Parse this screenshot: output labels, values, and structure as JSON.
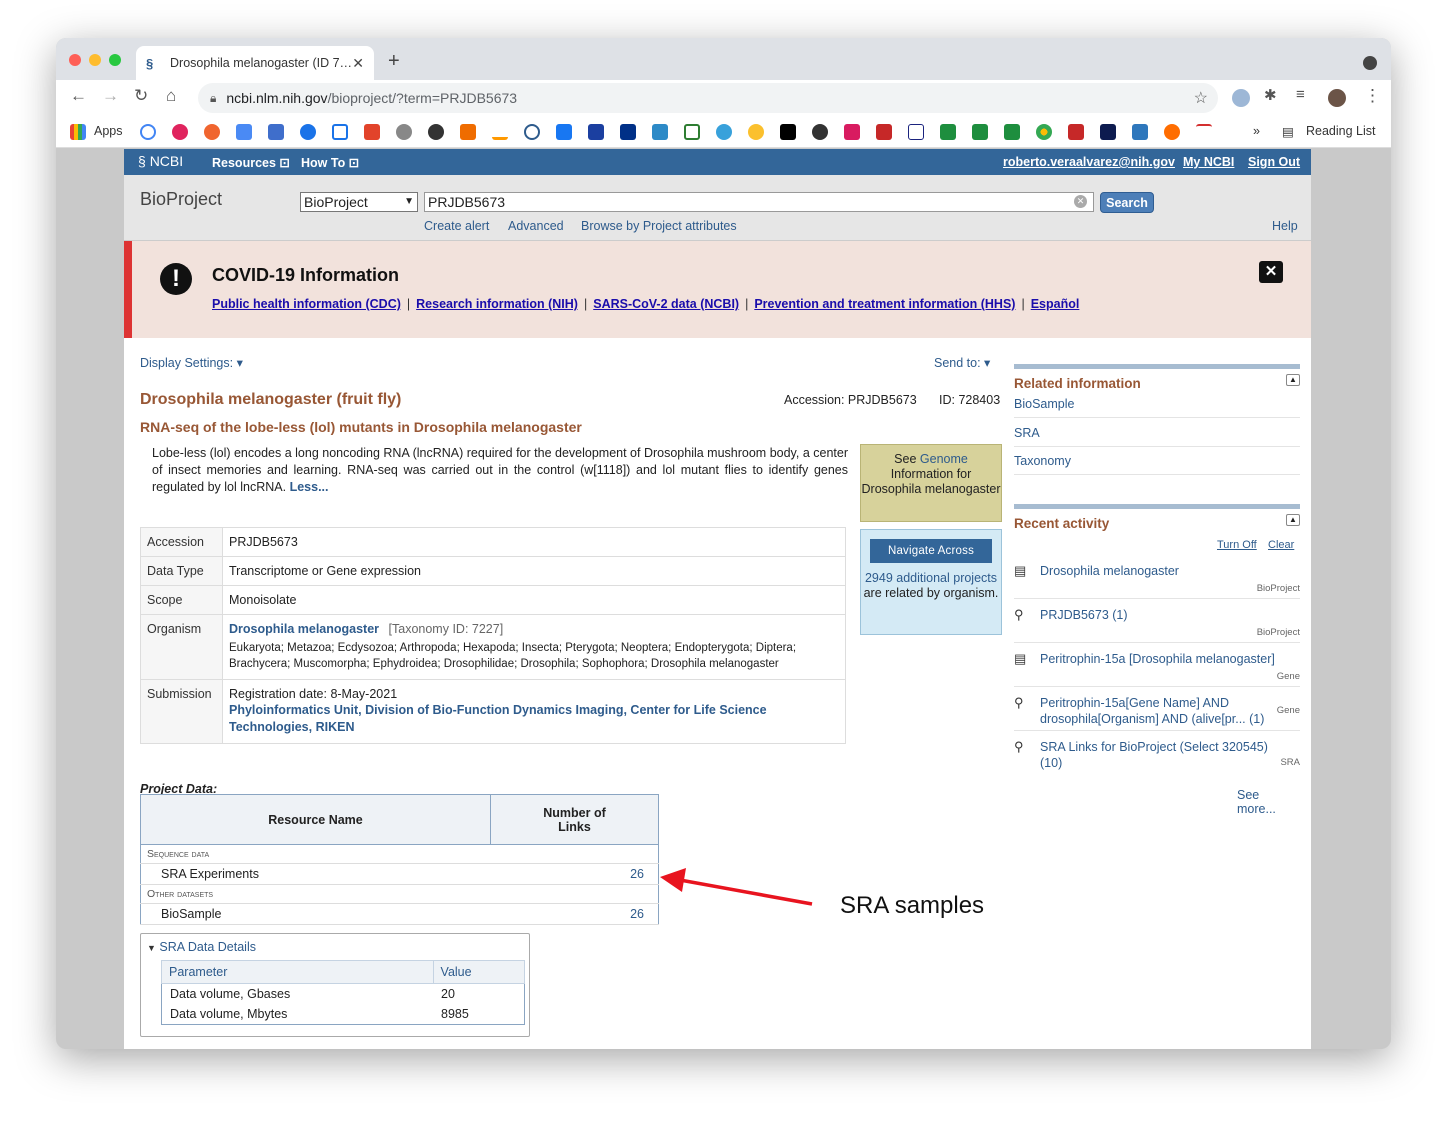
{
  "browser": {
    "tab_title": "Drosophila melanogaster (ID 7…",
    "url_domain": "ncbi.nlm.nih.gov",
    "url_path": "/bioproject/?term=PRJDB5673",
    "bookmarks_apps": "Apps",
    "bookmarks_more": "»",
    "reading_list": "Reading List"
  },
  "ncbi_bar": {
    "logo": "NCBI",
    "resources": "Resources",
    "how_to": "How To",
    "user": "roberto.veraalvarez@nih.gov",
    "my_ncbi": "My NCBI",
    "sign_out": "Sign Out"
  },
  "search": {
    "db_title": "BioProject",
    "db_selected": "BioProject",
    "term": "PRJDB5673",
    "button": "Search",
    "create_alert": "Create alert",
    "advanced": "Advanced",
    "browse": "Browse by Project attributes",
    "help": "Help"
  },
  "covid": {
    "title": "COVID-19 Information",
    "links": [
      "Public health information (CDC)",
      "Research information (NIH)",
      "SARS-CoV-2 data (NCBI)",
      "Prevention and treatment information (HHS)",
      "Español"
    ],
    "separator": "|"
  },
  "display_settings": "Display Settings:",
  "send_to": "Send to:",
  "record": {
    "organism_title": "Drosophila melanogaster (fruit fly)",
    "accession_label": "Accession: PRJDB5673",
    "id_label": "ID: 728403",
    "project_title": "RNA-seq of the lobe-less (lol) mutants in Drosophila melanogaster",
    "description": "Lobe-less (lol) encodes a long noncoding RNA (lncRNA) required for the development of Drosophila mushroom body, a center of insect memories and learning. RNA-seq was carried out in the control (w[1118]) and lol mutant flies to identify genes regulated by lol lncRNA.",
    "less": "Less..."
  },
  "genome_box": {
    "see": "See",
    "genome": "Genome",
    "rest": "Information for Drosophila melanogaster"
  },
  "navigate_box": {
    "heading": "Navigate Across",
    "link": "2949 additional projects",
    "rest": "are related by organism."
  },
  "info_table": {
    "accession_label": "Accession",
    "accession": "PRJDB5673",
    "data_type_label": "Data Type",
    "data_type": "Transcriptome or Gene expression",
    "scope_label": "Scope",
    "scope": "Monoisolate",
    "organism_label": "Organism",
    "organism": "Drosophila melanogaster",
    "taxonomy": "[Taxonomy ID: 7227]",
    "lineage": "Eukaryota; Metazoa; Ecdysozoa; Arthropoda; Hexapoda; Insecta; Pterygota; Neoptera; Endopterygota; Diptera; Brachycera; Muscomorpha; Ephydroidea; Drosophilidae; Drosophila; Sophophora; Drosophila melanogaster",
    "submission_label": "Submission",
    "registration": "Registration date: 8-May-2021",
    "submitter": "Phyloinformatics Unit, Division of Bio-Function Dynamics Imaging, Center for Life Science Technologies, RIKEN"
  },
  "project_data": {
    "heading": "Project Data:",
    "col_resource": "Resource Name",
    "col_links": "Number of Links",
    "cat_sequence": "Sequence data",
    "sra_experiments": "SRA Experiments",
    "sra_count": "26",
    "cat_other": "Other datasets",
    "biosample": "BioSample",
    "biosample_count": "26"
  },
  "sra_details": {
    "heading": "SRA Data Details",
    "col_param": "Parameter",
    "col_value": "Value",
    "rows": [
      {
        "param": "Data volume, Gbases",
        "value": "20"
      },
      {
        "param": "Data volume, Mbytes",
        "value": "8985"
      }
    ]
  },
  "related": {
    "title": "Related information",
    "links": [
      "BioSample",
      "SRA",
      "Taxonomy"
    ]
  },
  "recent": {
    "title": "Recent activity",
    "turn_off": "Turn Off",
    "clear": "Clear",
    "items": [
      {
        "text": "Drosophila melanogaster",
        "db": "BioProject",
        "icon": "document-icon"
      },
      {
        "text": "PRJDB5673 (1)",
        "db": "BioProject",
        "icon": "search-icon"
      },
      {
        "text": "Peritrophin-15a [Drosophila melanogaster]",
        "db": "Gene",
        "icon": "document-icon"
      },
      {
        "text": "Peritrophin-15a[Gene Name] AND drosophila[Organism] AND (alive[pr... (1)",
        "db": "Gene",
        "icon": "search-icon"
      },
      {
        "text": "SRA Links for BioProject (Select 320545) (10)",
        "db": "SRA",
        "icon": "search-icon"
      }
    ],
    "see_more": "See more..."
  },
  "annotation": "SRA samples",
  "colors": {
    "ncbi_blue": "#336699",
    "accent_brown": "#985735",
    "link": "#2e5b8c",
    "arrow": "#e8141f"
  }
}
